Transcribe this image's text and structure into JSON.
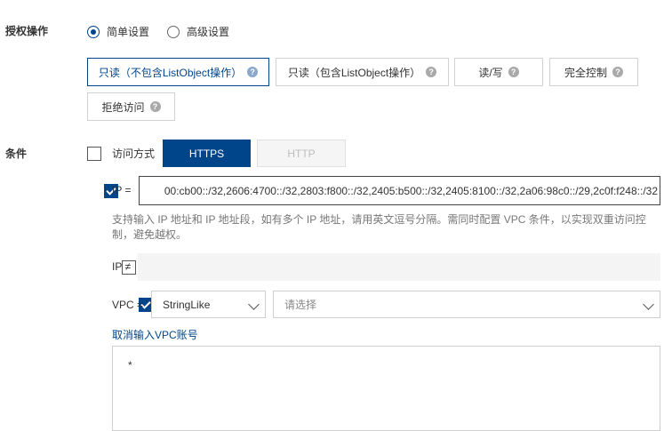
{
  "auth": {
    "label": "授权操作",
    "modes": [
      {
        "label": "简单设置",
        "checked": true
      },
      {
        "label": "高级设置",
        "checked": false
      }
    ],
    "permissions": [
      {
        "label": "只读（不包含ListObject操作）",
        "selected": true
      },
      {
        "label": "只读（包含ListObject操作）",
        "selected": false
      },
      {
        "label": "读/写",
        "selected": false
      },
      {
        "label": "完全控制",
        "selected": false
      },
      {
        "label": "拒绝访问",
        "selected": false
      }
    ],
    "help_glyph": "?"
  },
  "conditions": {
    "label": "条件",
    "access": {
      "label": "访问方式",
      "checked": false,
      "options": [
        "HTTPS",
        "HTTP"
      ],
      "selected": "HTTPS"
    },
    "ip_eq": {
      "label": "IP =",
      "checked": true,
      "value": "00:cb00::/32,2606:4700::/32,2803:f800::/32,2405:b500::/32,2405:8100::/32,2a06:98c0::/29,2c0f:f248::/32",
      "helper": "支持输入 IP 地址和 IP 地址段，如有多个 IP 地址，请用英文逗号分隔。需同时配置 VPC 条件，以实现双重访问控制，避免越权。"
    },
    "ip_ne": {
      "label": "IP ≠",
      "checked": false,
      "value": ""
    },
    "vpc": {
      "label": "VPC =",
      "checked": true,
      "operator": "StringLike",
      "placeholder": "请选择",
      "cancel_link": "取消输入VPC账号",
      "account_value": "*"
    }
  },
  "colors": {
    "primary": "#00458a",
    "border": "#d1d1d1"
  }
}
